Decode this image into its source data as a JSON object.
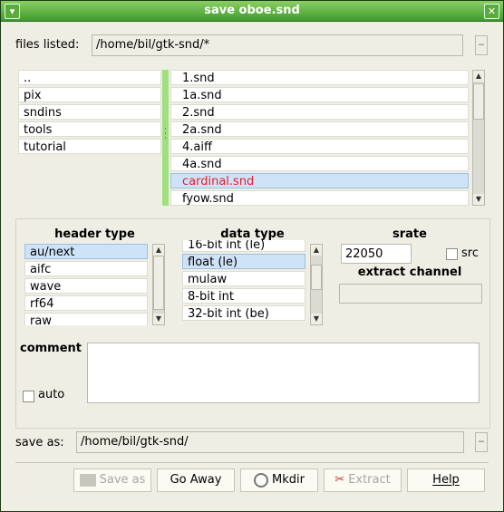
{
  "window": {
    "title": "save oboe.snd",
    "menu_glyph": "▾",
    "close_glyph": "✕"
  },
  "files": {
    "label": "files listed:",
    "path": "/home/bil/gtk-snd/*",
    "dirs": [
      "..",
      "pix",
      "sndins",
      "tools",
      "tutorial"
    ],
    "files": [
      "1.snd",
      "1a.snd",
      "2.snd",
      "2a.snd",
      "4.aiff",
      "4a.snd",
      "cardinal.snd",
      "fyow.snd"
    ],
    "selected_file": "cardinal.snd",
    "selected_color": "#e0212b"
  },
  "header_type": {
    "label": "header type",
    "items": [
      "au/next",
      "aifc",
      "wave",
      "rf64",
      "raw"
    ],
    "selected": "au/next"
  },
  "data_type": {
    "label": "data type",
    "items": [
      "16-bit int (le)",
      "float (le)",
      "mulaw",
      "8-bit int",
      "32-bit int (be)"
    ],
    "selected": "float (le)"
  },
  "srate": {
    "label": "srate",
    "value": "22050",
    "src_label": "src"
  },
  "extract": {
    "label": "extract channel",
    "value": ""
  },
  "comment": {
    "label": "comment",
    "value": "",
    "auto_label": "auto"
  },
  "save_as": {
    "label": "save as:",
    "path": "/home/bil/gtk-snd/"
  },
  "buttons": {
    "save_as": "Save as",
    "go_away": "Go Away",
    "mkdir": "Mkdir",
    "extract": "Extract",
    "help": "Help"
  },
  "colors": {
    "titlebar": "#5fb544",
    "splitter": "#9ee07c",
    "selection": "#cfe3f8"
  }
}
